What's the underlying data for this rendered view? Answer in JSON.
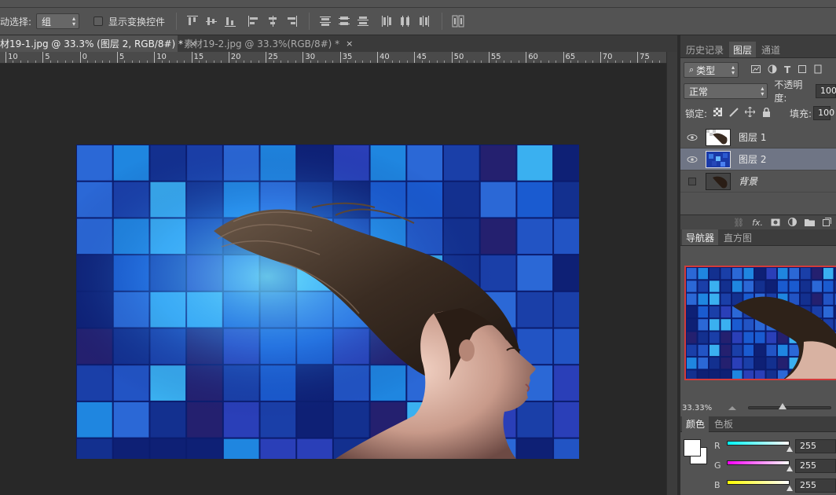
{
  "options_bar": {
    "auto_select_label": "动选择:",
    "auto_select_value": "组",
    "show_transform_label": "显示变换控件"
  },
  "tabs": [
    {
      "label": "材19-1.jpg @ 33.3% (图层 2, RGB/8#) *",
      "close": "×"
    },
    {
      "label": "素材19-2.jpg @ 33.3%(RGB/8#) *",
      "close": "×"
    }
  ],
  "ruler": [
    "10",
    "5",
    "0",
    "5",
    "10",
    "15",
    "20",
    "25",
    "30",
    "35",
    "40",
    "45",
    "50",
    "55",
    "60",
    "65",
    "70",
    "75"
  ],
  "panel": {
    "tabs": [
      "历史记录",
      "图层",
      "通道"
    ],
    "filter_label": "类型",
    "blend_mode": "正常",
    "opacity_label": "不透明度:",
    "opacity_value": "100",
    "lock_label": "锁定:",
    "fill_label": "填充:",
    "fill_value": "100",
    "layers": [
      {
        "name": "图层 1",
        "visible": true,
        "selected": false
      },
      {
        "name": "图层 2",
        "visible": true,
        "selected": true
      },
      {
        "name": "背景",
        "visible": false,
        "selected": false
      }
    ],
    "nav_tabs": [
      "导航器",
      "直方图"
    ],
    "zoom": "33.33%",
    "color_tabs": [
      "颜色",
      "色板"
    ],
    "channels": [
      {
        "label": "R",
        "value": "255"
      },
      {
        "label": "G",
        "value": "255"
      },
      {
        "label": "B",
        "value": "255"
      }
    ]
  },
  "colors": {
    "accent_selected": "#6f7585",
    "nav_frame": "#d23b3b"
  }
}
